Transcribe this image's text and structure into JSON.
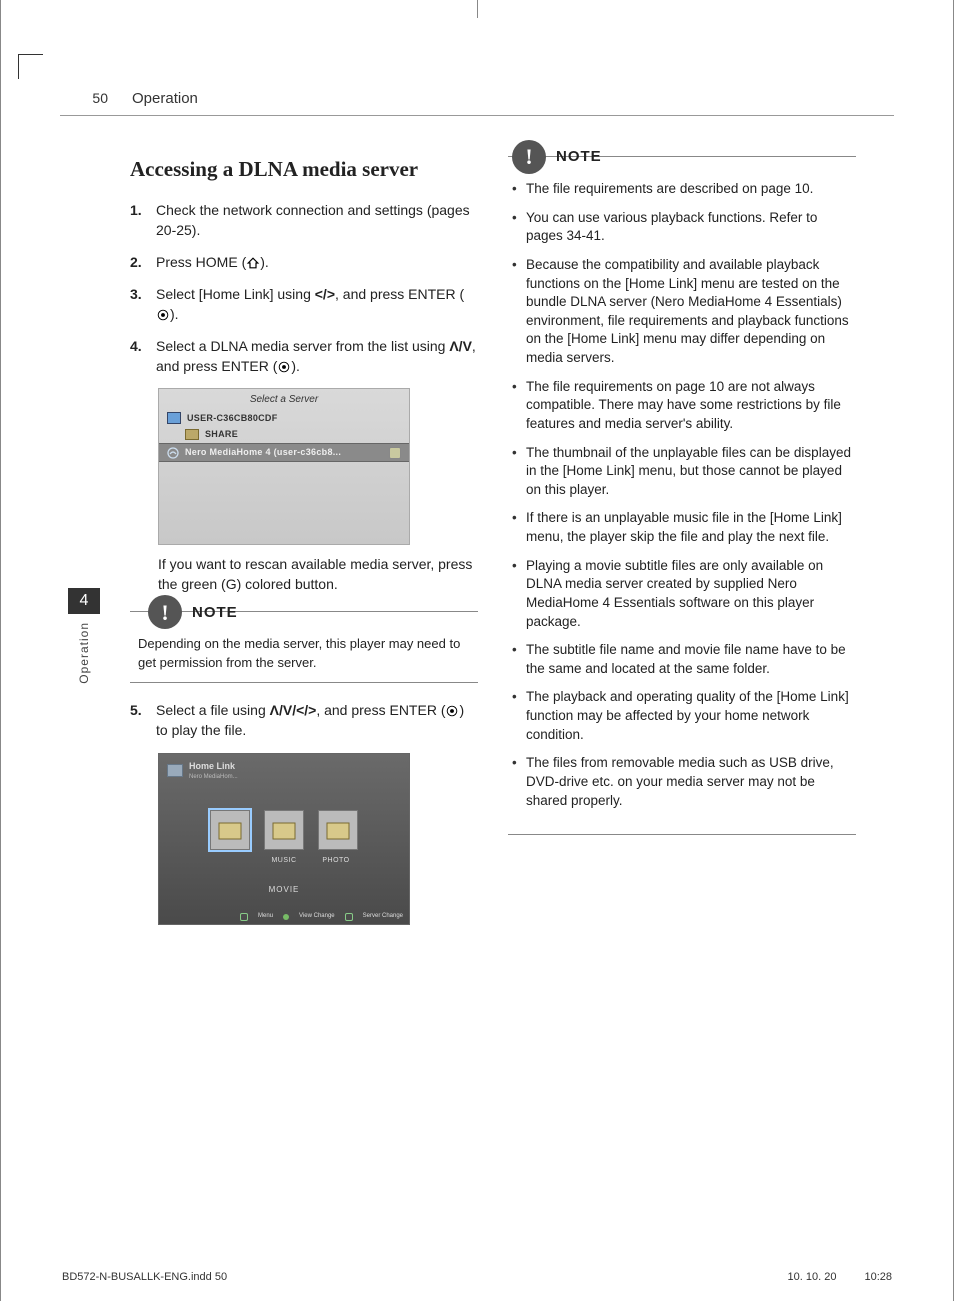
{
  "header": {
    "page_num": "50",
    "section": "Operation"
  },
  "side_tab": {
    "num": "4",
    "label": "Operation"
  },
  "heading": "Accessing a DLNA media server",
  "steps": {
    "s1": {
      "n": "1.",
      "text": "Check the network connection and settings (pages 20-25)."
    },
    "s2": {
      "n": "2.",
      "pre": "Press HOME (",
      "post": ")."
    },
    "s3": {
      "n": "3.",
      "pre": "Select [Home Link] using ",
      "arrows": "</>",
      "mid": ", and press ENTER (",
      "post": ")."
    },
    "s4": {
      "n": "4.",
      "pre": "Select a DLNA media server from the list using ",
      "arrows": "Λ/V",
      "mid": ", and press ENTER (",
      "post": ")."
    },
    "s5": {
      "n": "5.",
      "pre": "Select a file using ",
      "arrows": "Λ/V/</>",
      "mid": ", and press ENTER (",
      "post": ") to play the file."
    }
  },
  "shot1": {
    "title": "Select a Server",
    "row1": "USER-C36CB80CDF",
    "row2": "SHARE",
    "row3": "Nero MediaHome 4 (user-c36cb8..."
  },
  "after_shot1": "If you want to rescan available media server, press the green (G) colored button.",
  "note1": {
    "label": "NOTE",
    "text": "Depending on the media server, this player may need to get permission from the server."
  },
  "shot2": {
    "title": "Home Link",
    "sub": "Nero MediaHom...",
    "t1": "",
    "t2": "MUSIC",
    "t3": "PHOTO",
    "movie": "MOVIE",
    "f1": "Menu",
    "f2": "View Change",
    "f3": "Server Change"
  },
  "note2": {
    "label": "NOTE",
    "items": [
      "The file requirements are described on page 10.",
      "You can use various playback functions. Refer to pages 34-41.",
      "Because the compatibility and available playback functions on the [Home Link] menu are tested on the bundle DLNA server (Nero MediaHome 4 Essentials) environment, file requirements and playback functions on the [Home Link] menu may differ depending on media servers.",
      "The file requirements on page 10 are not always compatible. There may have some restrictions by file features and media server's ability.",
      "The thumbnail of the unplayable files can be displayed in the [Home Link] menu, but those cannot be played on this player.",
      "If there is an unplayable music file in the [Home Link] menu, the player skip the file and play the next file.",
      "Playing a movie subtitle files are only available on DLNA media server created by supplied Nero MediaHome 4 Essentials software on this player package.",
      "The subtitle file name and movie file name have to be the same and located at the same folder.",
      "The playback and operating quality of the [Home Link] function may be affected by your home network condition.",
      "The files from removable media such as USB drive, DVD-drive etc. on your media server may not be shared properly."
    ]
  },
  "footer": {
    "file": "BD572-N-BUSALLK-ENG.indd   50",
    "date": "10. 10. 20",
    "time": "10:28"
  },
  "icons": {
    "bang": "!"
  }
}
